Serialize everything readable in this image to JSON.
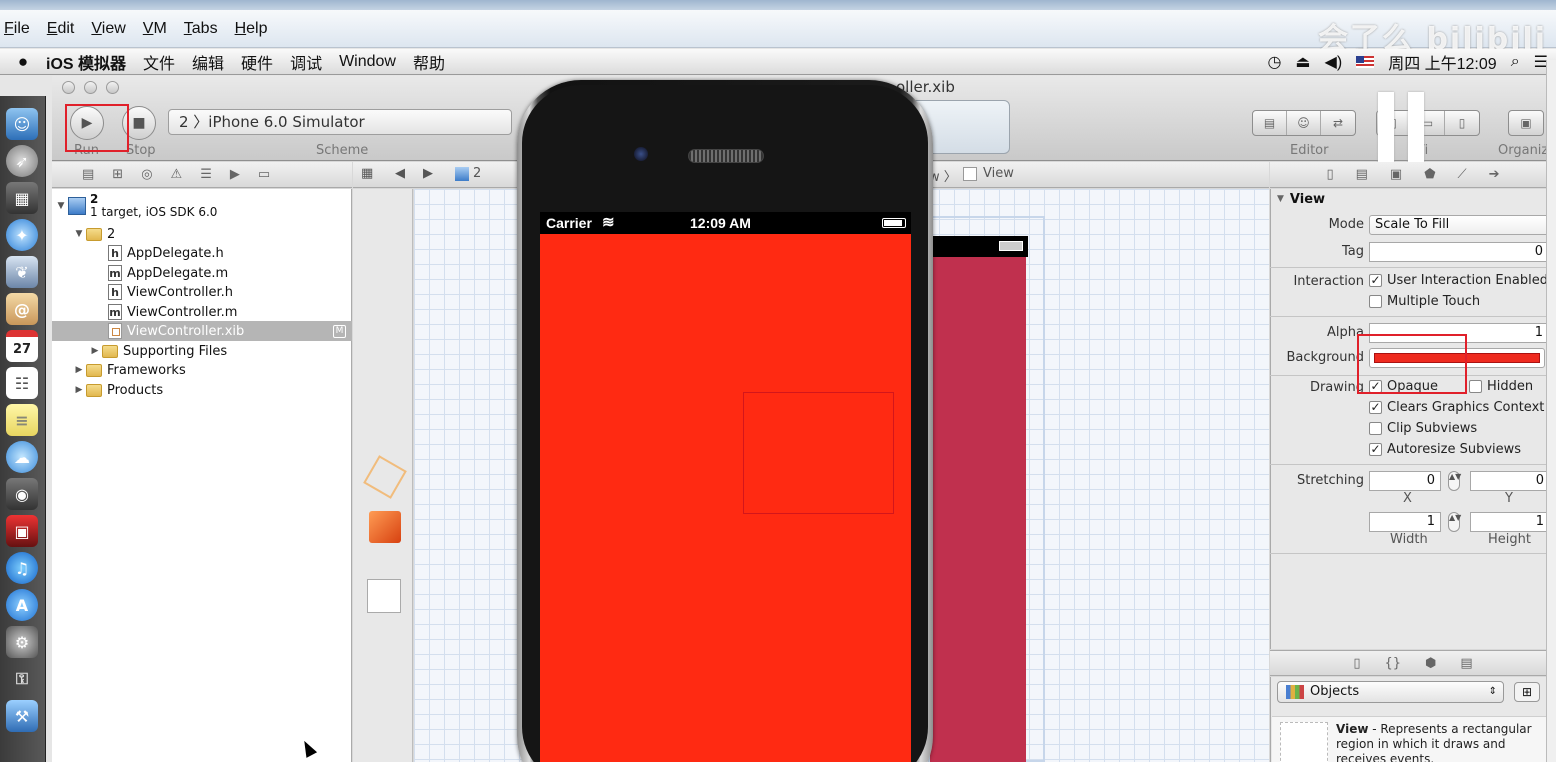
{
  "vmware": {
    "menu": [
      "File",
      "Edit",
      "View",
      "VM",
      "Tabs",
      "Help"
    ]
  },
  "watermark": "会了么 bilibili",
  "mac_menubar": {
    "app": "iOS 模拟器",
    "menus": [
      "文件",
      "编辑",
      "硬件",
      "调试",
      "Window",
      "帮助"
    ],
    "clock": "周四 上午12:09"
  },
  "dock": {
    "icons": [
      "finder-icon",
      "launchpad-icon",
      "dashboard-icon",
      "safari-icon",
      "preview-icon",
      "mail-icon",
      "calendar-icon",
      "reminders-icon",
      "notes-icon",
      "messages-icon",
      "facetime-icon",
      "photo-booth-icon",
      "itunes-icon",
      "app-store-icon",
      "system-preferences-icon",
      "keychain-icon",
      "xcode-icon"
    ],
    "calendar_day": "27"
  },
  "toolbar": {
    "run_label": "Run",
    "stop_label": "Stop",
    "scheme_value": "2 〉iPhone 6.0 Simulator",
    "scheme_label": "Scheme",
    "editor_label": "Editor",
    "view_label": "Vi",
    "organizer_label": "Organiz",
    "document_title": "oller.xib"
  },
  "navigator": {
    "project_name": "2",
    "project_sub": "1 target, iOS SDK 6.0",
    "group": "2",
    "files": [
      {
        "name": "AppDelegate.h",
        "type": "h"
      },
      {
        "name": "AppDelegate.m",
        "type": "m"
      },
      {
        "name": "ViewController.h",
        "type": "h"
      },
      {
        "name": "ViewController.m",
        "type": "m"
      },
      {
        "name": "ViewController.xib",
        "type": "xib",
        "badge": "M"
      }
    ],
    "folders": [
      "Supporting Files",
      "Frameworks",
      "Products"
    ]
  },
  "jump_bar": {
    "crumb_project": "2",
    "crumb_partial": "w 〉",
    "crumb_view": "View"
  },
  "simulator": {
    "carrier": "Carrier",
    "time": "12:09 AM",
    "background_color": "#ff2a12"
  },
  "ib_view_color": "#c0304e",
  "inspector": {
    "section": "View",
    "mode_label": "Mode",
    "mode_value": "Scale To Fill",
    "tag_label": "Tag",
    "tag_value": "0",
    "interaction_label": "Interaction",
    "user_interaction": "User Interaction Enabled",
    "multiple_touch": "Multiple Touch",
    "alpha_label": "Alpha",
    "alpha_value": "1",
    "background_label": "Background",
    "background_color": "#ee2a1f",
    "drawing_label": "Drawing",
    "opaque": "Opaque",
    "hidden": "Hidden",
    "clears_graphics": "Clears Graphics Context",
    "clip_subviews": "Clip Subviews",
    "autoresize": "Autoresize Subviews",
    "stretching_label": "Stretching",
    "stretch_x": "0",
    "stretch_y": "0",
    "x_label": "X",
    "y_label": "Y",
    "stretch_w": "1",
    "stretch_h": "1",
    "width_label": "Width",
    "height_label": "Height"
  },
  "library": {
    "selector": "Objects",
    "item_title": "View",
    "item_desc": " - Represents a rectangular region in which it draws and receives events."
  }
}
